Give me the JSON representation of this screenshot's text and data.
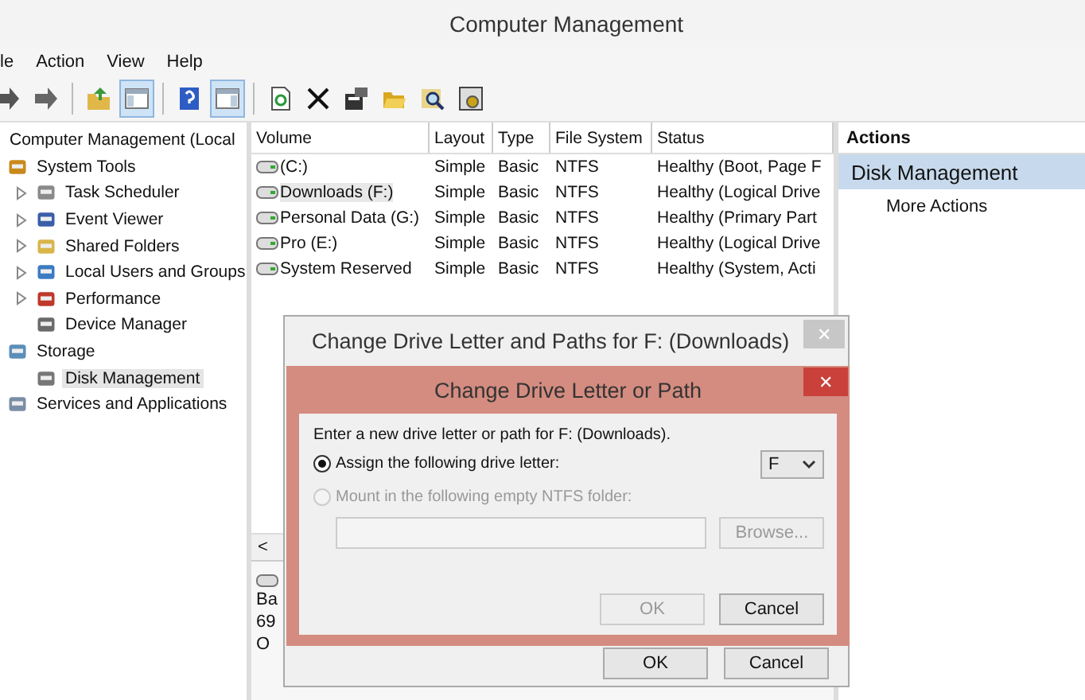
{
  "window": {
    "title": "Computer Management"
  },
  "menu": [
    "le",
    "Action",
    "View",
    "Help"
  ],
  "toolbar": [
    {
      "kind": "forward",
      "pressed": false
    },
    {
      "kind": "up",
      "pressed": false
    },
    {
      "kind": "tree",
      "pressed": true
    },
    {
      "kind": "help",
      "pressed": false
    },
    {
      "kind": "pane",
      "pressed": true
    },
    {
      "kind": "refresh",
      "pressed": false
    },
    {
      "kind": "delete",
      "pressed": false
    },
    {
      "kind": "properties",
      "pressed": false
    },
    {
      "kind": "open",
      "pressed": false
    },
    {
      "kind": "search",
      "pressed": false
    },
    {
      "kind": "settings",
      "pressed": false
    }
  ],
  "tree": {
    "label": "Computer Management (Local",
    "children": [
      {
        "label": "System Tools",
        "expandable": false,
        "selected": false,
        "children": [
          {
            "label": "Task Scheduler",
            "expandable": true,
            "selected": false
          },
          {
            "label": "Event Viewer",
            "expandable": true,
            "selected": false
          },
          {
            "label": "Shared Folders",
            "expandable": true,
            "selected": false
          },
          {
            "label": "Local Users and Groups",
            "expandable": true,
            "selected": false
          },
          {
            "label": "Performance",
            "expandable": true,
            "selected": false
          },
          {
            "label": "Device Manager",
            "expandable": false,
            "selected": false
          }
        ]
      },
      {
        "label": "Storage",
        "expandable": false,
        "selected": false,
        "children": [
          {
            "label": "Disk Management",
            "expandable": false,
            "selected": true
          }
        ]
      },
      {
        "label": "Services and Applications",
        "expandable": false,
        "selected": false
      }
    ]
  },
  "table": {
    "columns": [
      "Volume",
      "Layout",
      "Type",
      "File System",
      "Status"
    ],
    "rows": [
      {
        "cells": [
          "(C:)",
          "Simple",
          "Basic",
          "NTFS",
          "Healthy (Boot, Page F"
        ],
        "selected": false
      },
      {
        "cells": [
          "Downloads (F:)",
          "Simple",
          "Basic",
          "NTFS",
          "Healthy (Logical Drive"
        ],
        "selected": true
      },
      {
        "cells": [
          "Personal Data (G:)",
          "Simple",
          "Basic",
          "NTFS",
          "Healthy (Primary Part"
        ],
        "selected": false
      },
      {
        "cells": [
          "Pro (E:)",
          "Simple",
          "Basic",
          "NTFS",
          "Healthy (Logical Drive"
        ],
        "selected": false
      },
      {
        "cells": [
          "System Reserved",
          "Simple",
          "Basic",
          "NTFS",
          "Healthy (System, Acti"
        ],
        "selected": false
      }
    ]
  },
  "lower_pane": {
    "scroll_arrow": "<",
    "disk_lines": [
      "Ba",
      "69",
      "O"
    ]
  },
  "actions": {
    "title": "Actions",
    "section": "Disk Management",
    "items": [
      "More Actions"
    ]
  },
  "outer_dialog": {
    "title": "Change Drive Letter and Paths for F: (Downloads)",
    "close": "✕",
    "buttons": [
      "OK",
      "Cancel"
    ]
  },
  "dialog": {
    "title": "Change Drive Letter or Path",
    "close": "✕",
    "prompt": "Enter a new drive letter or path for F: (Downloads).",
    "options": [
      {
        "label": "Assign the following drive letter:",
        "selected": true,
        "disabled": false
      },
      {
        "label": "Mount in the following empty NTFS folder:",
        "selected": false,
        "disabled": true
      }
    ],
    "drive_letter": "F",
    "folder_field": {
      "disabled": true
    },
    "browse": {
      "label": "Browse...",
      "disabled": true
    },
    "buttons": [
      {
        "label": "OK",
        "disabled": true
      },
      {
        "label": "Cancel",
        "disabled": false
      }
    ]
  }
}
